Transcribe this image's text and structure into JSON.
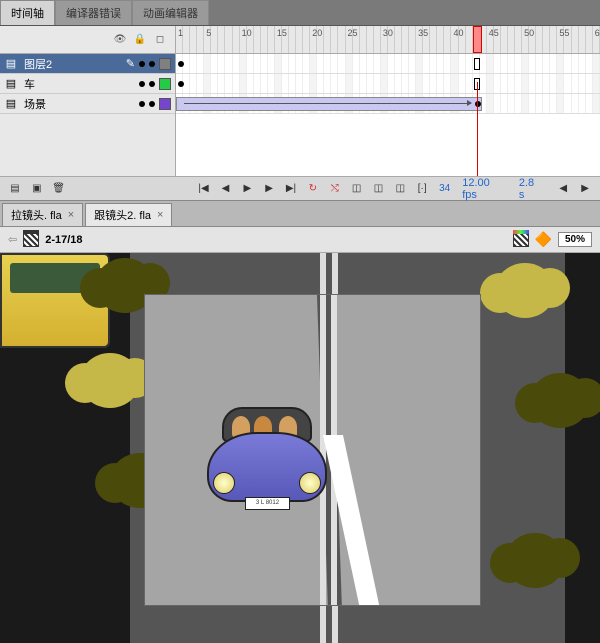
{
  "tabs": {
    "timeline": "时间轴",
    "compiler": "编译器错误",
    "animedit": "动画编辑器"
  },
  "layers": [
    {
      "name": "图层2",
      "color": "#808080",
      "selected": true
    },
    {
      "name": "车",
      "color": "#22cc44",
      "selected": false
    },
    {
      "name": "场景",
      "color": "#7744cc",
      "selected": false
    }
  ],
  "ruler": {
    "marks": [
      1,
      5,
      10,
      15,
      20,
      25,
      30,
      35,
      40,
      45,
      50,
      55
    ]
  },
  "playhead_frame": 34,
  "footer": {
    "frame": "34",
    "fps": "12.00",
    "fps_unit": "fps",
    "time": "2.8",
    "time_unit": "s"
  },
  "files": [
    {
      "name": "拉镜头. fla",
      "active": false
    },
    {
      "name": "跟镜头2. fla",
      "active": true
    }
  ],
  "scene": {
    "label": "2-17/18",
    "zoom": "50%"
  },
  "car": {
    "plate": "3 L 8012"
  }
}
